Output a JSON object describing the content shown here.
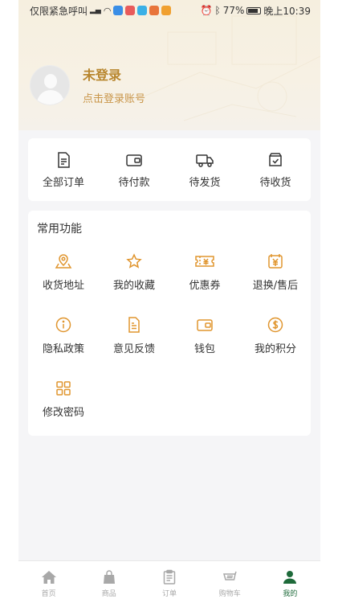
{
  "status_bar": {
    "carrier": "仅限紧急呼叫",
    "battery": "77%",
    "time": "晚上10:39"
  },
  "profile": {
    "name": "未登录",
    "subtitle": "点击登录账号"
  },
  "orders": [
    {
      "label": "全部订单",
      "icon": "document-list-icon"
    },
    {
      "label": "待付款",
      "icon": "wallet-icon"
    },
    {
      "label": "待发货",
      "icon": "truck-icon"
    },
    {
      "label": "待收货",
      "icon": "box-check-icon"
    }
  ],
  "common": {
    "title": "常用功能",
    "items": [
      {
        "label": "收货地址",
        "icon": "map-pin-icon"
      },
      {
        "label": "我的收藏",
        "icon": "star-icon"
      },
      {
        "label": "优惠券",
        "icon": "coupon-icon"
      },
      {
        "label": "退换/售后",
        "icon": "refund-icon"
      },
      {
        "label": "隐私政策",
        "icon": "info-icon"
      },
      {
        "label": "意见反馈",
        "icon": "feedback-icon"
      },
      {
        "label": "钱包",
        "icon": "wallet-icon"
      },
      {
        "label": "我的积分",
        "icon": "points-icon"
      },
      {
        "label": "修改密码",
        "icon": "grid-icon"
      }
    ]
  },
  "tabbar": [
    {
      "label": "首页",
      "icon": "home-icon",
      "active": false
    },
    {
      "label": "商品",
      "icon": "bag-icon",
      "active": false
    },
    {
      "label": "订单",
      "icon": "clipboard-icon",
      "active": false
    },
    {
      "label": "购物车",
      "icon": "cart-icon",
      "active": false
    },
    {
      "label": "我的",
      "icon": "person-icon",
      "active": true
    }
  ],
  "colors": {
    "accent": "#e0952e",
    "profile_name": "#b8862e",
    "active_tab": "#1e6a3a",
    "inactive_tab": "#a8a8a8"
  }
}
